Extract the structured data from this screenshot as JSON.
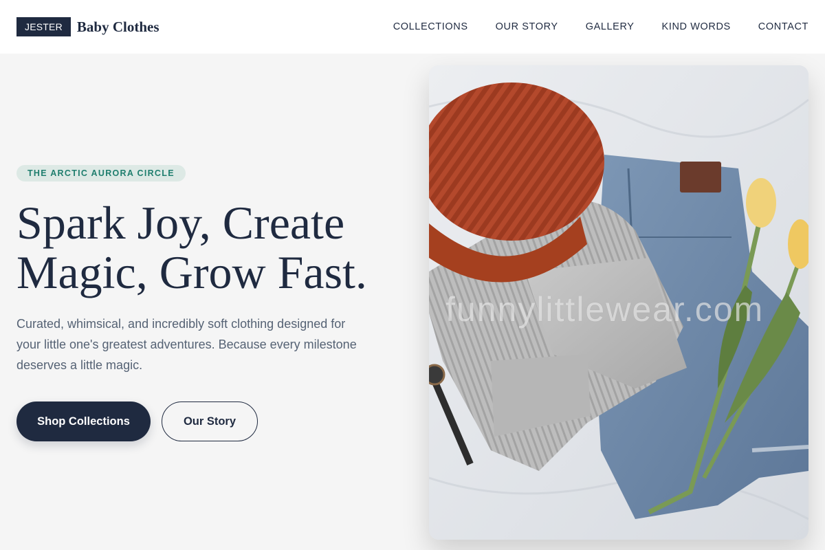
{
  "brand": {
    "badge": "JESTER",
    "name": "Baby Clothes"
  },
  "nav": {
    "items": [
      {
        "label": "COLLECTIONS"
      },
      {
        "label": "OUR STORY"
      },
      {
        "label": "GALLERY"
      },
      {
        "label": "KIND WORDS"
      },
      {
        "label": "CONTACT"
      }
    ]
  },
  "hero": {
    "eyebrow": "THE ARCTIC AURORA CIRCLE",
    "headline_line1": "Spark Joy, Create",
    "headline_line2": "Magic, Grow Fast.",
    "subtext": "Curated, whimsical, and incredibly soft clothing designed for your little one's greatest adventures. Because every milestone deserves a little magic.",
    "primary_button": "Shop Collections",
    "secondary_button": "Our Story",
    "image_watermark": "funnylittlewear.com"
  },
  "colors": {
    "primary": "#1f2a40",
    "accent": "#1f7e6e",
    "accent_bg": "#dde9e5",
    "background": "#f5f5f5"
  }
}
